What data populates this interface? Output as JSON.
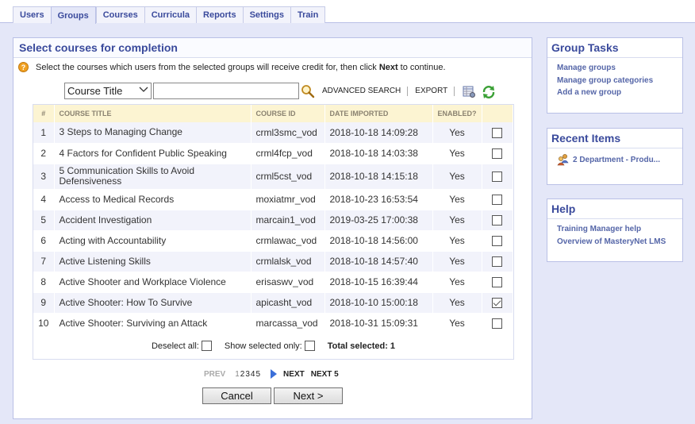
{
  "tabs": [
    "Users",
    "Groups",
    "Courses",
    "Curricula",
    "Reports",
    "Settings",
    "Train"
  ],
  "active_tab": "Groups",
  "main": {
    "title": "Select courses for completion",
    "instruction_pre": "Select the courses which users from the selected groups will receive credit for, then click ",
    "instruction_bold": "Next",
    "instruction_post": " to continue.",
    "search_field_selected": "Course Title",
    "search_value": "",
    "advanced_search": "ADVANCED SEARCH",
    "export": "EXPORT",
    "columns": [
      "#",
      "COURSE TITLE",
      "COURSE ID",
      "DATE IMPORTED",
      "ENABLED?",
      ""
    ],
    "rows": [
      {
        "num": "1",
        "title": "3 Steps to Managing Change",
        "id": "crml3smc_vod",
        "date": "2018-10-18 14:09:28",
        "enabled": "Yes",
        "checked": false
      },
      {
        "num": "2",
        "title": "4 Factors for Confident Public Speaking",
        "id": "crml4fcp_vod",
        "date": "2018-10-18 14:03:38",
        "enabled": "Yes",
        "checked": false
      },
      {
        "num": "3",
        "title": "5 Communication Skills to Avoid Defensiveness",
        "id": "crml5cst_vod",
        "date": "2018-10-18 14:15:18",
        "enabled": "Yes",
        "checked": false
      },
      {
        "num": "4",
        "title": "Access to Medical Records",
        "id": "moxiatmr_vod",
        "date": "2018-10-23 16:53:54",
        "enabled": "Yes",
        "checked": false
      },
      {
        "num": "5",
        "title": "Accident Investigation",
        "id": "marcain1_vod",
        "date": "2019-03-25 17:00:38",
        "enabled": "Yes",
        "checked": false
      },
      {
        "num": "6",
        "title": "Acting with Accountability",
        "id": "crmlawac_vod",
        "date": "2018-10-18 14:56:00",
        "enabled": "Yes",
        "checked": false
      },
      {
        "num": "7",
        "title": "Active Listening Skills",
        "id": "crmlalsk_vod",
        "date": "2018-10-18 14:57:40",
        "enabled": "Yes",
        "checked": false
      },
      {
        "num": "8",
        "title": "Active Shooter and Workplace Violence",
        "id": "erisaswv_vod",
        "date": "2018-10-15 16:39:44",
        "enabled": "Yes",
        "checked": false
      },
      {
        "num": "9",
        "title": "Active Shooter: How To Survive",
        "id": "apicasht_vod",
        "date": "2018-10-10 15:00:18",
        "enabled": "Yes",
        "checked": true
      },
      {
        "num": "10",
        "title": "Active Shooter: Surviving an Attack",
        "id": "marcassa_vod",
        "date": "2018-10-31 15:09:31",
        "enabled": "Yes",
        "checked": false
      }
    ],
    "deselect_all": "Deselect all:",
    "show_selected_only": "Show selected only:",
    "total_selected_label": "Total selected:",
    "total_selected_value": "1",
    "pager": {
      "prev": "PREV",
      "pages": [
        "1",
        "2",
        "3",
        "4",
        "5"
      ],
      "next": "NEXT",
      "next5": "NEXT 5"
    },
    "cancel": "Cancel",
    "next_button": "Next >"
  },
  "group_tasks": {
    "title": "Group Tasks",
    "links": [
      "Manage groups",
      "Manage group categories",
      "Add a new group"
    ]
  },
  "recent_items": {
    "title": "Recent Items",
    "item": "2 Department - Produ..."
  },
  "help": {
    "title": "Help",
    "links": [
      "Training Manager help",
      "Overview of MasteryNet LMS"
    ]
  }
}
